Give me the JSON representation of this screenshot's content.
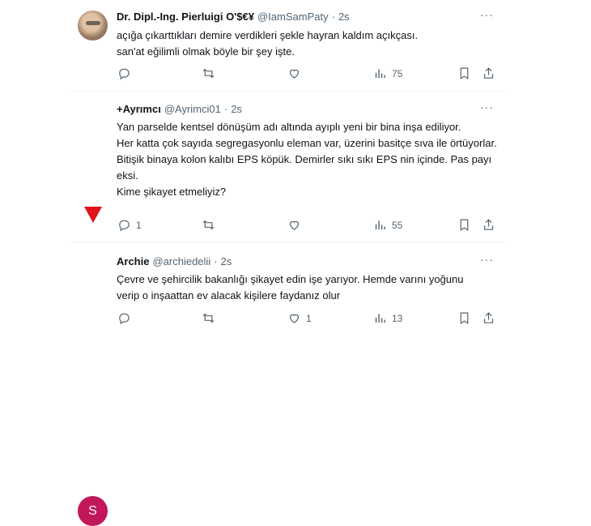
{
  "tweets": [
    {
      "name": "Dr. Dipl.-Ing. Pierluigi O'$€¥",
      "handle": "@IamSamPaty",
      "dot": "·",
      "time": "2s",
      "text": "açığa çıkarttıkları demire verdikleri şekle hayran kaldım açıkçası.\nsan'at eğilimli olmak böyle bir şey işte.",
      "reply_count": "",
      "retweet_count": "",
      "like_count": "",
      "views": "75"
    },
    {
      "name": "+Ayrımcı",
      "handle": "@Ayrimci01",
      "dot": "·",
      "time": "2s",
      "text": "Yan parselde kentsel dönüşüm adı altında  ayıplı yeni bir bina inşa ediliyor.\nHer katta çok sayıda segregasyonlu eleman var, üzerini basitçe sıva ile örtüyorlar.\nBitişik binaya kolon kalıbı EPS köpük. Demirler sıkı sıkı EPS nin içinde. Pas payı eksi.\nKime şikayet etmeliyiz?",
      "reply_count": "1",
      "retweet_count": "",
      "like_count": "",
      "views": "55"
    },
    {
      "name": "Archie",
      "handle": "@archiedelii",
      "dot": "·",
      "time": "2s",
      "avatar_letter": "S",
      "text": "Çevre ve şehircilik bakanlığı şikayet edin işe yarıyor. Hemde varını yoğunu\nverip o inşaattan ev alacak kişilere faydanız olur",
      "reply_count": "",
      "retweet_count": "",
      "like_count": "1",
      "views": "13"
    }
  ],
  "more_icon": "···",
  "colors": {
    "text": "#0f1419",
    "muted": "#536471",
    "divider": "#eff3f4",
    "archie_avatar": "#c2185b",
    "ayrimci_flag": "#e0121b"
  }
}
